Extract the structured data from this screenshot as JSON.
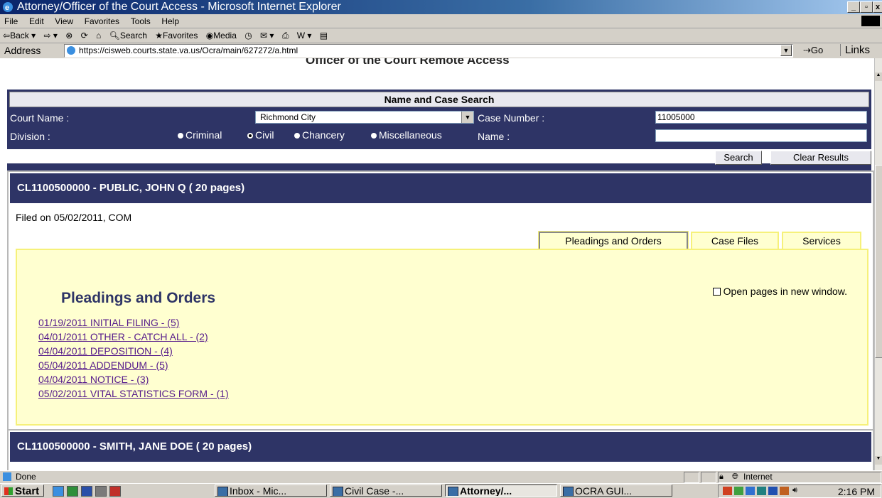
{
  "window": {
    "title": "Attorney/Officer of the Court Access - Microsoft Internet Explorer"
  },
  "menu": [
    "File",
    "Edit",
    "View",
    "Favorites",
    "Tools",
    "Help"
  ],
  "toolbar": {
    "back": "Back",
    "search": "Search",
    "favorites": "Favorites",
    "media": "Media"
  },
  "address": {
    "label": "Address",
    "url": "https://cisweb.courts.state.va.us/Ocra/main/627272/a.html",
    "go": "Go",
    "links": "Links"
  },
  "page": {
    "cut_heading": "Officer of the Court Remote Access",
    "search": {
      "title": "Name and Case Search",
      "court_label": "Court Name :",
      "court_value": "Richmond City",
      "case_label": "Case Number :",
      "case_value": "11005000",
      "division_label": "Division :",
      "divisions": [
        "Criminal",
        "Civil",
        "Chancery",
        "Miscellaneous"
      ],
      "division_selected": "Civil",
      "name_label": "Name :",
      "name_value": "",
      "search_button": "Search",
      "clear_button": "Clear Results"
    },
    "case1": {
      "header": "CL1100500000 - PUBLIC, JOHN Q ( 20 pages)",
      "filed": "Filed on 05/02/2011, COM",
      "tabs": [
        "Pleadings and Orders",
        "Case Files",
        "Services"
      ],
      "section_title": "Pleadings and Orders",
      "open_new_window": "Open pages in new window.",
      "documents": [
        "01/19/2011 INITIAL FILING - (5)",
        "04/01/2011 OTHER - CATCH ALL - (2)",
        "04/04/2011 DEPOSITION - (4)",
        "05/04/2011 ADDENDUM - (5)",
        "04/04/2011 NOTICE - (3)",
        "05/02/2011 VITAL STATISTICS FORM - (1)"
      ]
    },
    "case2": {
      "header": "CL1100500000 - SMITH, JANE DOE ( 20 pages)"
    }
  },
  "status": {
    "text": "Done",
    "zone": "Internet"
  },
  "taskbar": {
    "start": "Start",
    "buttons": [
      "Inbox - Mic...",
      "Civil Case -...",
      "Attorney/...",
      "OCRA GUI..."
    ],
    "active": "Attorney/...",
    "clock": "2:16 PM"
  },
  "colors": {
    "navy": "#2e3466",
    "yellow_panel": "#ffffd0",
    "yellow_border": "#f6f17a",
    "link": "#551a8b"
  }
}
